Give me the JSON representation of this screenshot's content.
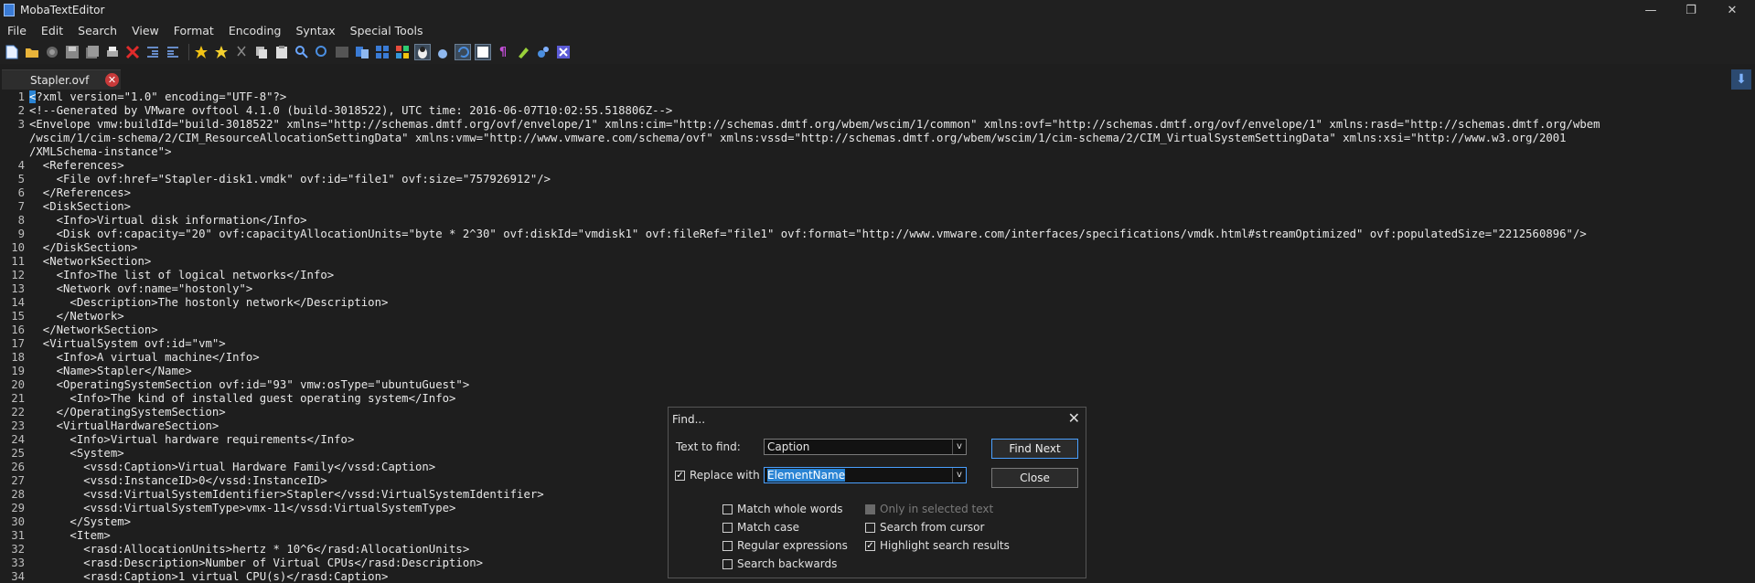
{
  "window": {
    "title": "MobaTextEditor"
  },
  "window_controls": {
    "minimize": "—",
    "restore": "❐",
    "close": "✕"
  },
  "menu": [
    "File",
    "Edit",
    "Search",
    "View",
    "Format",
    "Encoding",
    "Syntax",
    "Special Tools"
  ],
  "tab": {
    "label": "Stapler.ovf",
    "close": "✕",
    "right_button": "⬇"
  },
  "lines": [
    {
      "n": "1",
      "caret": "<",
      "text": "?xml version=\"1.0\" encoding=\"UTF-8\"?>"
    },
    {
      "n": "2",
      "text": "<!--Generated by VMware ovftool 4.1.0 (build-3018522), UTC time: 2016-06-07T10:02:55.518806Z-->"
    },
    {
      "n": "3",
      "text": "<Envelope vmw:buildId=\"build-3018522\" xmlns=\"http://schemas.dmtf.org/ovf/envelope/1\" xmlns:cim=\"http://schemas.dmtf.org/wbem/wscim/1/common\" xmlns:ovf=\"http://schemas.dmtf.org/ovf/envelope/1\" xmlns:rasd=\"http://schemas.dmtf.org/wbem"
    },
    {
      "n": "",
      "text": "/wscim/1/cim-schema/2/CIM_ResourceAllocationSettingData\" xmlns:vmw=\"http://www.vmware.com/schema/ovf\" xmlns:vssd=\"http://schemas.dmtf.org/wbem/wscim/1/cim-schema/2/CIM_VirtualSystemSettingData\" xmlns:xsi=\"http://www.w3.org/2001"
    },
    {
      "n": "",
      "text": "/XMLSchema-instance\">"
    },
    {
      "n": "4",
      "text": "  <References>"
    },
    {
      "n": "5",
      "text": "    <File ovf:href=\"Stapler-disk1.vmdk\" ovf:id=\"file1\" ovf:size=\"757926912\"/>"
    },
    {
      "n": "6",
      "text": "  </References>"
    },
    {
      "n": "7",
      "text": "  <DiskSection>"
    },
    {
      "n": "8",
      "text": "    <Info>Virtual disk information</Info>"
    },
    {
      "n": "9",
      "text": "    <Disk ovf:capacity=\"20\" ovf:capacityAllocationUnits=\"byte * 2^30\" ovf:diskId=\"vmdisk1\" ovf:fileRef=\"file1\" ovf:format=\"http://www.vmware.com/interfaces/specifications/vmdk.html#streamOptimized\" ovf:populatedSize=\"2212560896\"/>"
    },
    {
      "n": "10",
      "text": "  </DiskSection>"
    },
    {
      "n": "11",
      "text": "  <NetworkSection>"
    },
    {
      "n": "12",
      "text": "    <Info>The list of logical networks</Info>"
    },
    {
      "n": "13",
      "text": "    <Network ovf:name=\"hostonly\">"
    },
    {
      "n": "14",
      "text": "      <Description>The hostonly network</Description>"
    },
    {
      "n": "15",
      "text": "    </Network>"
    },
    {
      "n": "16",
      "text": "  </NetworkSection>"
    },
    {
      "n": "17",
      "text": "  <VirtualSystem ovf:id=\"vm\">"
    },
    {
      "n": "18",
      "text": "    <Info>A virtual machine</Info>"
    },
    {
      "n": "19",
      "text": "    <Name>Stapler</Name>"
    },
    {
      "n": "20",
      "text": "    <OperatingSystemSection ovf:id=\"93\" vmw:osType=\"ubuntuGuest\">"
    },
    {
      "n": "21",
      "text": "      <Info>The kind of installed guest operating system</Info>"
    },
    {
      "n": "22",
      "text": "    </OperatingSystemSection>"
    },
    {
      "n": "23",
      "text": "    <VirtualHardwareSection>"
    },
    {
      "n": "24",
      "text": "      <Info>Virtual hardware requirements</Info>"
    },
    {
      "n": "25",
      "text": "      <System>"
    },
    {
      "n": "26",
      "text": "        <vssd:Caption>Virtual Hardware Family</vssd:Caption>"
    },
    {
      "n": "27",
      "text": "        <vssd:InstanceID>0</vssd:InstanceID>"
    },
    {
      "n": "28",
      "text": "        <vssd:VirtualSystemIdentifier>Stapler</vssd:VirtualSystemIdentifier>"
    },
    {
      "n": "29",
      "text": "        <vssd:VirtualSystemType>vmx-11</vssd:VirtualSystemType>"
    },
    {
      "n": "30",
      "text": "      </System>"
    },
    {
      "n": "31",
      "text": "      <Item>"
    },
    {
      "n": "32",
      "text": "        <rasd:AllocationUnits>hertz * 10^6</rasd:AllocationUnits>"
    },
    {
      "n": "33",
      "text": "        <rasd:Description>Number of Virtual CPUs</rasd:Description>"
    },
    {
      "n": "34",
      "text": "        <rasd:Caption>1 virtual CPU(s)</rasd:Caption>"
    }
  ],
  "find_dialog": {
    "title": "Find...",
    "close": "✕",
    "text_to_find_label": "Text to find:",
    "text_to_find_value": "Caption",
    "replace_with_label": "Replace with",
    "replace_with_value": "ElementName",
    "combo_arrow": "v",
    "find_next": "Find Next",
    "close_button": "Close",
    "check_mark": "✓",
    "options": {
      "match_whole_words": "Match whole words",
      "match_case": "Match case",
      "regular_expressions": "Regular expressions",
      "search_backwards": "Search backwards",
      "only_in_selected_text": "Only in selected text",
      "search_from_cursor": "Search from cursor",
      "highlight_search_results": "Highlight search results"
    }
  }
}
